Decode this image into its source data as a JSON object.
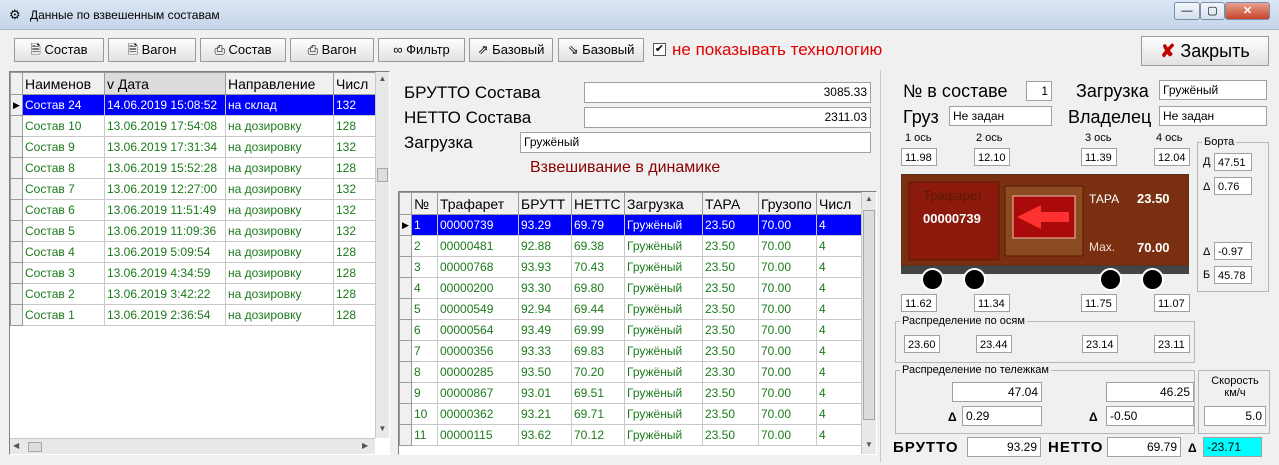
{
  "window": {
    "title": "Данные по взвешенным составам",
    "btn_min": "—",
    "btn_max": "▢",
    "btn_close": "✕"
  },
  "toolbar": {
    "btn1": "Состав",
    "btn2": "Вагон",
    "btn3": "Состав",
    "btn4": "Вагон",
    "btn5": "Фильтр",
    "btn6": "Базовый",
    "btn7": "Базовый",
    "check_mark": "✔",
    "hide_tech": "не показывать технологию",
    "close": "Закрыть"
  },
  "left": {
    "headers": [
      "Наименов",
      "v Дата",
      "Направление",
      "Числ"
    ],
    "rows": [
      {
        "name": "Состав 24",
        "date": "14.06.2019 15:08:52",
        "dir": "на склад",
        "n": "132"
      },
      {
        "name": "Состав 10",
        "date": "13.06.2019 17:54:08",
        "dir": "на дозировку",
        "n": "128"
      },
      {
        "name": "Состав 9",
        "date": "13.06.2019 17:31:34",
        "dir": "на дозировку",
        "n": "132"
      },
      {
        "name": "Состав 8",
        "date": "13.06.2019 15:52:28",
        "dir": "на дозировку",
        "n": "128"
      },
      {
        "name": "Состав 7",
        "date": "13.06.2019 12:27:00",
        "dir": "на дозировку",
        "n": "132"
      },
      {
        "name": "Состав 6",
        "date": "13.06.2019 11:51:49",
        "dir": "на дозировку",
        "n": "132"
      },
      {
        "name": "Состав 5",
        "date": "13.06.2019 11:09:36",
        "dir": "на дозировку",
        "n": "132"
      },
      {
        "name": "Состав 4",
        "date": "13.06.2019 5:09:54",
        "dir": "на дозировку",
        "n": "128"
      },
      {
        "name": "Состав 3",
        "date": "13.06.2019 4:34:59",
        "dir": "на дозировку",
        "n": "128"
      },
      {
        "name": "Состав 2",
        "date": "13.06.2019 3:42:22",
        "dir": "на дозировку",
        "n": "128"
      },
      {
        "name": "Состав 1",
        "date": "13.06.2019 2:36:54",
        "dir": "на дозировку",
        "n": "128"
      }
    ]
  },
  "summary": {
    "brutto_label": "БРУТТО Состава",
    "brutto": "3085.33",
    "netto_label": "НЕТТО Состава",
    "netto": "2311.03",
    "load_label": "Загрузка",
    "load": "Гружёный",
    "mode": "Взвешивание в динамике"
  },
  "wagons": {
    "headers": [
      "№",
      "Трафарет",
      "БРУТТ",
      "НЕТТС",
      "Загрузка",
      "ТАРА",
      "Грузопо",
      "Числ"
    ],
    "rows": [
      {
        "n": "1",
        "code": "00000739",
        "b": "93.29",
        "nt": "69.79",
        "load": "Гружёный",
        "tara": "23.50",
        "cap": "70.00",
        "ax": "4"
      },
      {
        "n": "2",
        "code": "00000481",
        "b": "92.88",
        "nt": "69.38",
        "load": "Гружёный",
        "tara": "23.50",
        "cap": "70.00",
        "ax": "4"
      },
      {
        "n": "3",
        "code": "00000768",
        "b": "93.93",
        "nt": "70.43",
        "load": "Гружёный",
        "tara": "23.50",
        "cap": "70.00",
        "ax": "4"
      },
      {
        "n": "4",
        "code": "00000200",
        "b": "93.30",
        "nt": "69.80",
        "load": "Гружёный",
        "tara": "23.50",
        "cap": "70.00",
        "ax": "4"
      },
      {
        "n": "5",
        "code": "00000549",
        "b": "92.94",
        "nt": "69.44",
        "load": "Гружёный",
        "tara": "23.50",
        "cap": "70.00",
        "ax": "4"
      },
      {
        "n": "6",
        "code": "00000564",
        "b": "93.49",
        "nt": "69.99",
        "load": "Гружёный",
        "tara": "23.50",
        "cap": "70.00",
        "ax": "4"
      },
      {
        "n": "7",
        "code": "00000356",
        "b": "93.33",
        "nt": "69.83",
        "load": "Гружёный",
        "tara": "23.50",
        "cap": "70.00",
        "ax": "4"
      },
      {
        "n": "8",
        "code": "00000285",
        "b": "93.50",
        "nt": "70.20",
        "load": "Гружёный",
        "tara": "23.30",
        "cap": "70.00",
        "ax": "4"
      },
      {
        "n": "9",
        "code": "00000867",
        "b": "93.01",
        "nt": "69.51",
        "load": "Гружёный",
        "tara": "23.50",
        "cap": "70.00",
        "ax": "4"
      },
      {
        "n": "10",
        "code": "00000362",
        "b": "93.21",
        "nt": "69.71",
        "load": "Гружёный",
        "tara": "23.50",
        "cap": "70.00",
        "ax": "4"
      },
      {
        "n": "11",
        "code": "00000115",
        "b": "93.62",
        "nt": "70.12",
        "load": "Гружёный",
        "tara": "23.50",
        "cap": "70.00",
        "ax": "4"
      }
    ]
  },
  "detail": {
    "num_label": "№ в составе",
    "num": "1",
    "load_label": "Загрузка",
    "load": "Гружёный",
    "cargo_label": "Груз",
    "cargo": "Не задан",
    "owner_label": "Владелец",
    "owner": "Не задан",
    "axle_labels": [
      "1 ось",
      "2 ось",
      "3 ось",
      "4 ось"
    ],
    "axle_top": [
      "11.98",
      "12.10",
      "11.39",
      "12.04"
    ],
    "axle_bottom": [
      "11.62",
      "11.34",
      "11.75",
      "11.07"
    ],
    "borta_title": "Борта",
    "borta_d_label": "Д",
    "borta_d": "47.51",
    "delta": "Δ",
    "borta_d_delta": "0.76",
    "borta_b_delta": "-0.97",
    "borta_b_label": "Б",
    "borta_b": "45.78",
    "wagon_stencil_label": "Трафарет",
    "wagon_stencil": "00000739",
    "wagon_tara_label": "ТАРА",
    "wagon_tara": "23.50",
    "wagon_max_label": "Мах.",
    "wagon_max": "70.00",
    "axle_dist_title": "Распределение по осям",
    "axle_dist": [
      "23.60",
      "23.44",
      "23.14",
      "23.11"
    ],
    "bogie_title": "Распределение по тележкам",
    "bogie1": "47.04",
    "bogie2": "46.25",
    "bogie1_delta": "0.29",
    "bogie2_delta": "-0.50",
    "speed_label": "Скорость км/ч",
    "speed": "5.0",
    "brutto_label": "БРУТТО",
    "brutto": "93.29",
    "netto_label": "НЕТТО",
    "netto": "69.79",
    "total_delta": "-23.71"
  }
}
